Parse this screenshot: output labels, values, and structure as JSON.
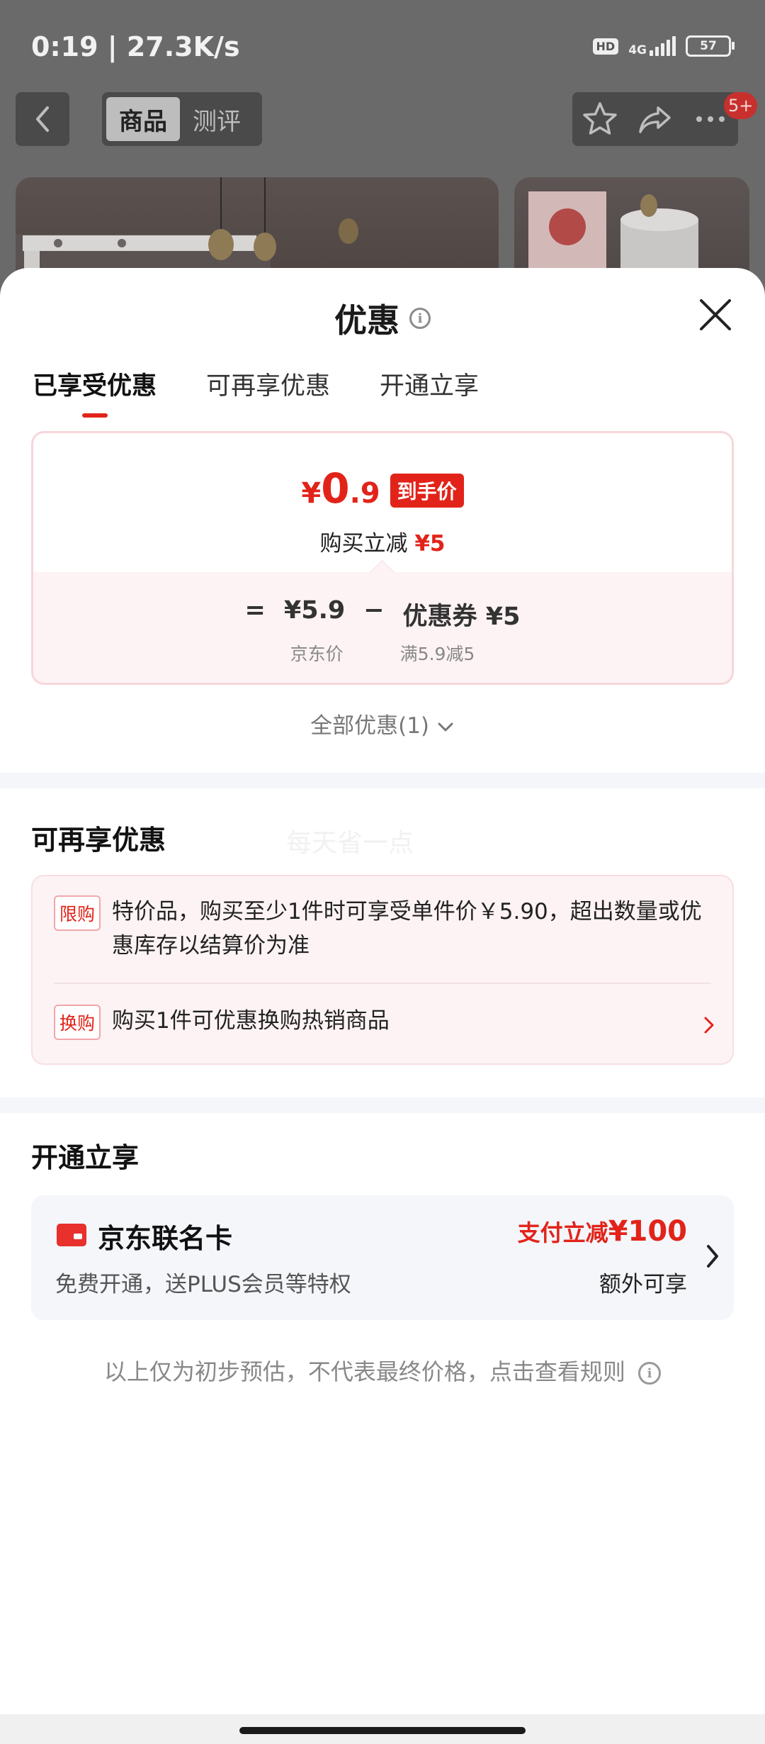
{
  "status_bar": {
    "time_speed": "0:19 | 27.3K/s",
    "hd": "HD",
    "network": "4G",
    "battery": "57"
  },
  "product_nav": {
    "tabs": [
      "商品",
      "测评"
    ],
    "active_tab": "商品",
    "more_badge": "5+"
  },
  "sheet": {
    "title": "优惠",
    "tabs": [
      {
        "label": "已享受优惠",
        "active": true
      },
      {
        "label": "可再享优惠",
        "active": false
      },
      {
        "label": "开通立享",
        "active": false
      }
    ],
    "price_card": {
      "currency": "¥",
      "price_int": "0",
      "price_dec": ".9",
      "final_tag": "到手价",
      "sub_label": "购买立减",
      "sub_amount": "¥5",
      "formula": {
        "eq": "=",
        "jd_price": "¥5.9",
        "minus": "−",
        "coupon": "优惠券 ¥5",
        "jd_price_label": "京东价",
        "coupon_label": "满5.9减5"
      }
    },
    "all_offers": "全部优惠(1)",
    "more_offers": {
      "title": "可再享优惠",
      "watermark": "每天省一点",
      "items": [
        {
          "tag": "限购",
          "text": "特价品，购买至少1件时可享受单件价￥5.90，超出数量或优惠库存以结算价为准"
        },
        {
          "tag": "换购",
          "text": "购买1件可优惠换购热销商品"
        }
      ]
    },
    "open_enjoy": {
      "title": "开通立享",
      "card_title": "京东联名卡",
      "card_desc": "免费开通，送PLUS会员等特权",
      "promo_prefix": "支付立减",
      "promo_amount": "¥100",
      "extra": "额外可享"
    },
    "disclaimer": "以上仅为初步预估，不代表最终价格，点击查看规则"
  },
  "colors": {
    "accent_red": "#e2231a",
    "overlay_bg": "#6f6d6d"
  }
}
